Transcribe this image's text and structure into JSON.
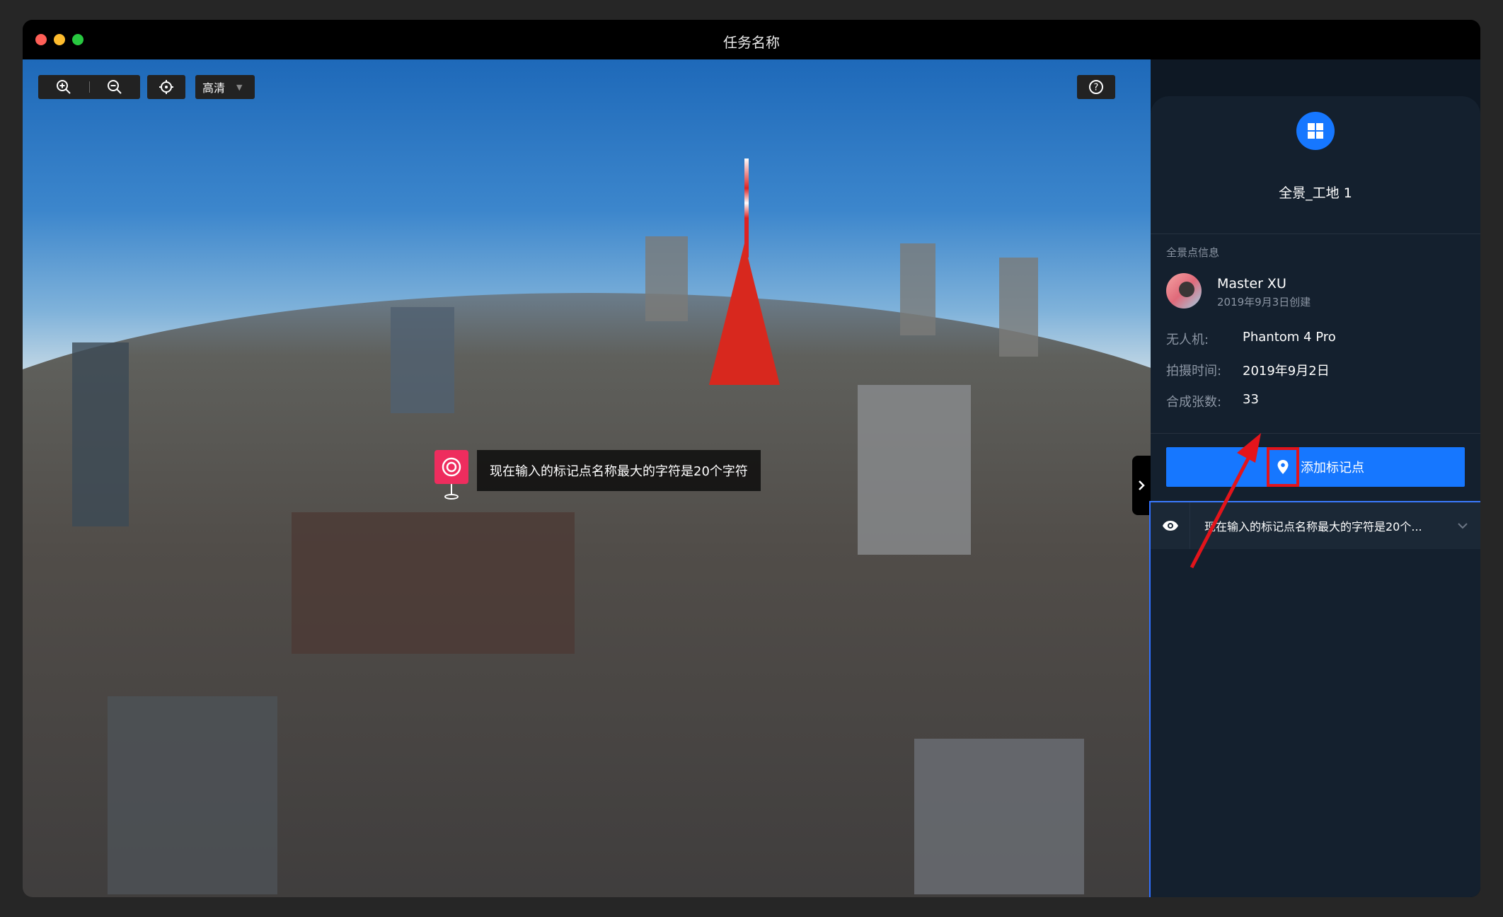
{
  "window": {
    "title": "任务名称",
    "traffic_lights": [
      "close",
      "minimize",
      "maximize"
    ]
  },
  "toolbar": {
    "zoom_in_icon": "zoom-in-icon",
    "zoom_out_icon": "zoom-out-icon",
    "locate_icon": "crosshair-icon",
    "quality_label": "高清",
    "help_icon": "help-icon"
  },
  "viewer": {
    "marker_label": "现在输入的标记点名称最大的字符是20个字符",
    "marker_icon": "target-icon",
    "collapse_icon": "chevron-right-icon"
  },
  "panel": {
    "logo_icon": "grid-icon",
    "title": "全景_工地 1",
    "section_label": "全景点信息",
    "user": {
      "name": "Master XU",
      "created": "2019年9月3日创建"
    },
    "info": [
      {
        "key": "无人机:",
        "value": "Phantom 4 Pro"
      },
      {
        "key": "拍摄时间:",
        "value": "2019年9月2日"
      },
      {
        "key": "合成张数:",
        "value": "33"
      }
    ],
    "add_button_label": "添加标记点",
    "add_button_icon": "location-pin-icon",
    "markers": [
      {
        "label": "现在输入的标记点名称最大的字符是20个...",
        "visibility_icon": "eye-icon",
        "expand_icon": "chevron-down-icon"
      }
    ]
  },
  "colors": {
    "accent": "#1677ff",
    "marker": "#ee2d5e",
    "annotation": "#e3141b",
    "panel_bg": "#14202e"
  }
}
